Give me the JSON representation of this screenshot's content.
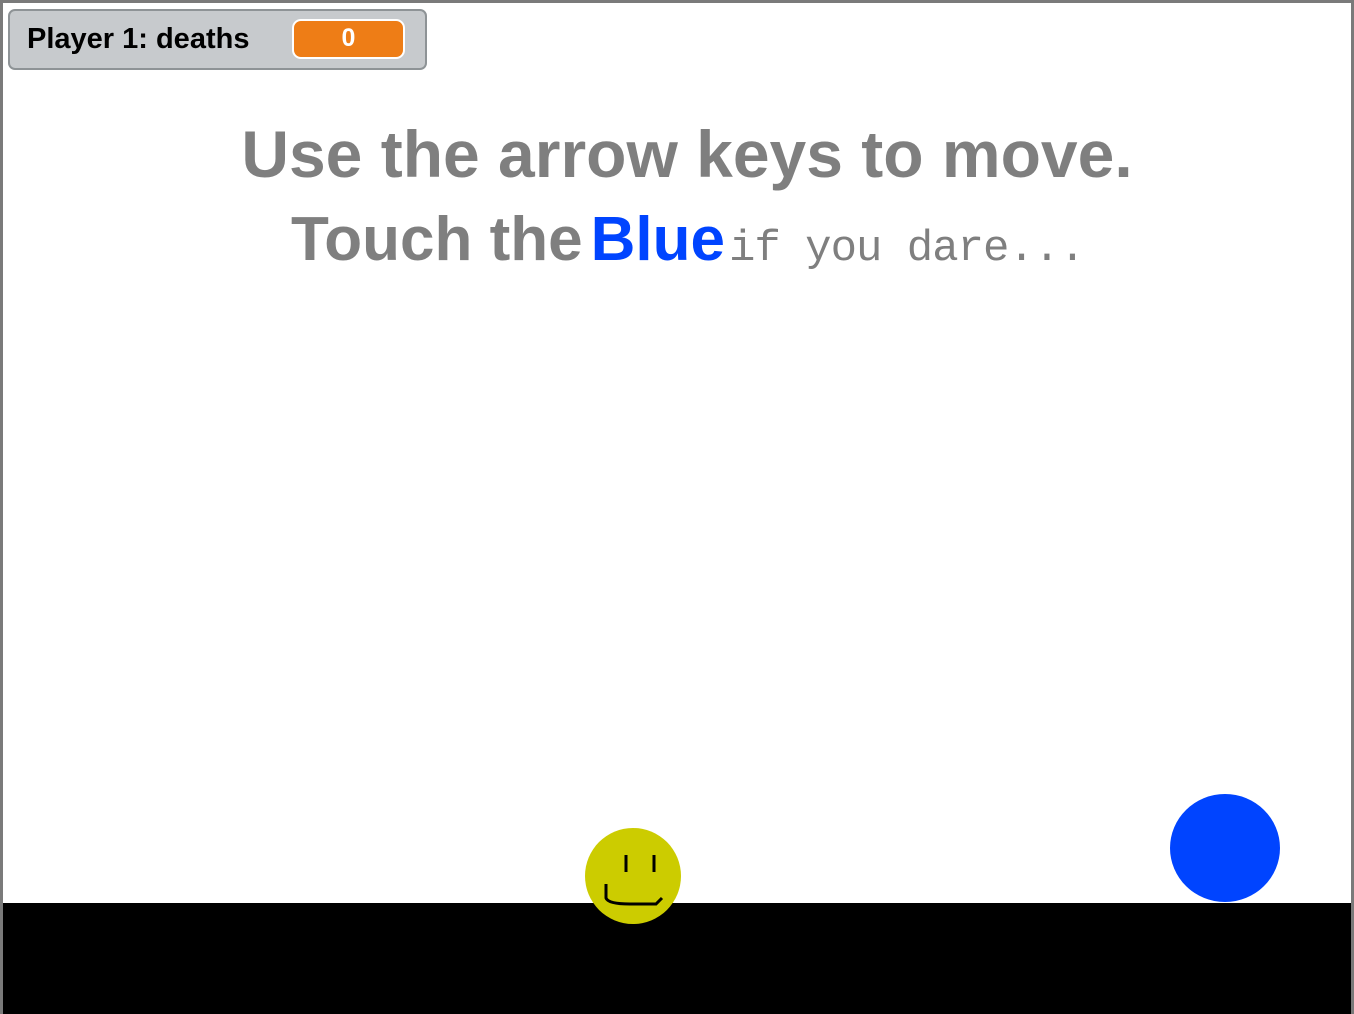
{
  "monitor": {
    "label": "Player 1: deaths",
    "value": "0"
  },
  "instructions": {
    "line1": "Use the arrow keys to move.",
    "line2_start": "Touch the",
    "line2_blue": "Blue",
    "line2_end": "if you dare..."
  },
  "colors": {
    "text_gray": "#7f7f7f",
    "blue": "#0044ff",
    "player_yellow": "#cccc00",
    "monitor_value_orange": "#ee7d16",
    "ground": "#000000"
  },
  "sprites": {
    "player_icon": "smiley-face",
    "enemy_icon": "blue-circle"
  }
}
